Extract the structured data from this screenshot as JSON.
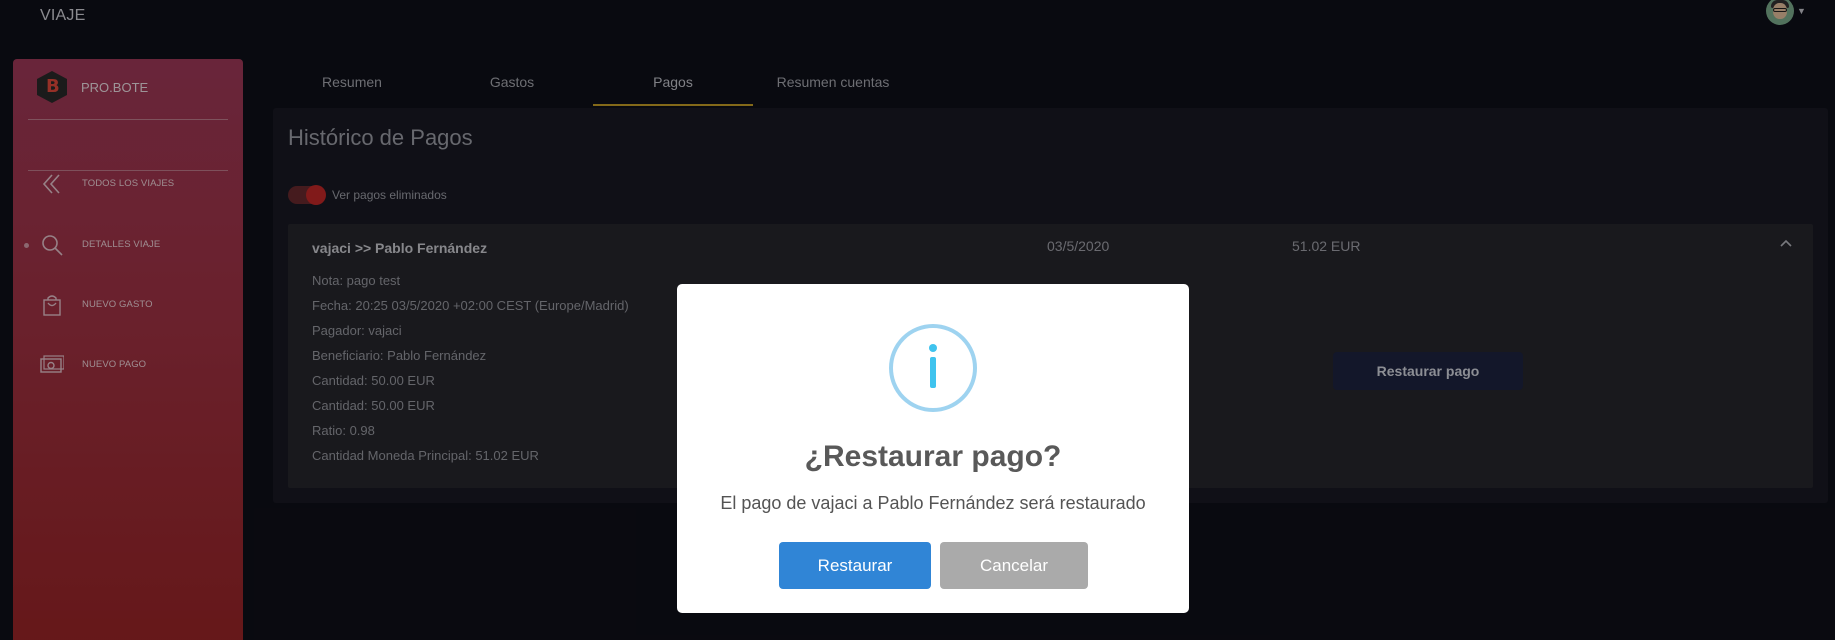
{
  "topbar": {
    "title": "VIAJE",
    "avatar_icon": "user-avatar",
    "caret_icon": "caret-down-icon"
  },
  "sidebar": {
    "brand_letter": "B",
    "brand_name": "PRO.BOTE",
    "items": [
      {
        "label": "TODOS LOS VIAJES",
        "icon": "double-chevron-left-icon"
      },
      {
        "label": "DETALLES VIAJE",
        "icon": "search-icon",
        "active": true
      },
      {
        "label": "NUEVO GASTO",
        "icon": "shopping-bag-icon"
      },
      {
        "label": "NUEVO PAGO",
        "icon": "money-icon"
      }
    ]
  },
  "tabs": [
    {
      "label": "Resumen"
    },
    {
      "label": "Gastos"
    },
    {
      "label": "Pagos",
      "active": true
    },
    {
      "label": "Resumen cuentas"
    }
  ],
  "panel": {
    "heading": "Histórico de Pagos",
    "toggle_label": "Ver pagos eliminados",
    "toggle_on": true
  },
  "payment": {
    "route": "vajaci >> Pablo Fernández",
    "date": "03/5/2020",
    "amount": "51.02 EUR",
    "details": [
      "Nota: pago test",
      "Fecha: 20:25 03/5/2020 +02:00 CEST (Europe/Madrid)",
      "Pagador: vajaci",
      "Beneficiario: Pablo Fernández",
      "Cantidad: 50.00 EUR",
      "Cantidad: 50.00 EUR",
      "Ratio: 0.98",
      "Cantidad Moneda Principal: 51.02 EUR"
    ],
    "restore_label": "Restaurar pago"
  },
  "modal": {
    "icon": "info-icon",
    "title": "¿Restaurar pago?",
    "text": "El pago de vajaci a Pablo Fernández será restaurado",
    "confirm_label": "Restaurar",
    "cancel_label": "Cancelar"
  },
  "colors": {
    "accent_tab": "#c9a227",
    "confirm": "#3085d6",
    "cancel": "#aaaaaa",
    "info": "#3fc3ee",
    "toggle": "#c62828"
  }
}
